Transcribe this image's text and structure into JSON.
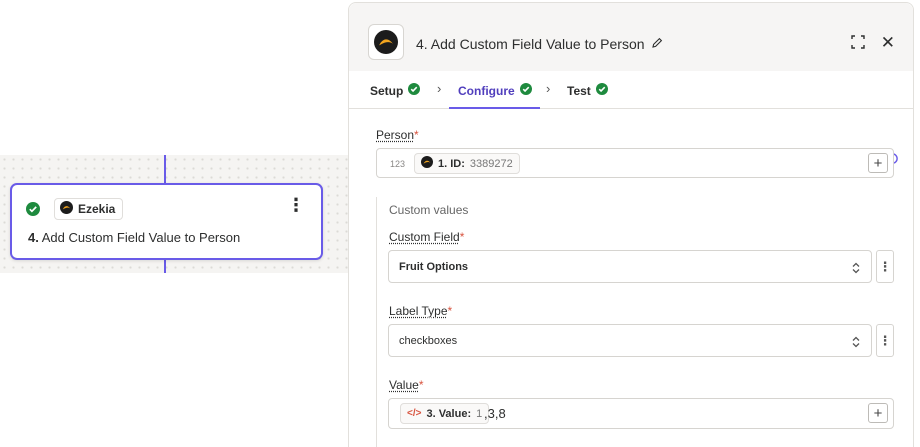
{
  "canvas": {
    "node": {
      "app_name": "Ezekia",
      "step_number": "4.",
      "step_title": "Add Custom Field Value to Person"
    }
  },
  "panel": {
    "title": "4. Add Custom Field Value to Person",
    "tabs": [
      {
        "label": "Setup",
        "done": true
      },
      {
        "label": "Configure",
        "done": true,
        "active": true
      },
      {
        "label": "Test",
        "done": true
      }
    ],
    "person": {
      "label": "Person",
      "type_hint": "123",
      "pill_key": "1. ID:",
      "pill_value": "3389272"
    },
    "custom_values": {
      "group_label": "Custom values",
      "custom_field": {
        "label": "Custom Field",
        "value": "Fruit Options"
      },
      "label_type": {
        "label": "Label Type",
        "value": "checkboxes"
      },
      "value": {
        "label": "Value",
        "pill_key": "3. Value:",
        "pill_value": "1",
        "suffix": ",3,8"
      }
    }
  },
  "colors": {
    "accent": "#695be8",
    "success": "#1e8a3e",
    "required": "#d8533e"
  }
}
